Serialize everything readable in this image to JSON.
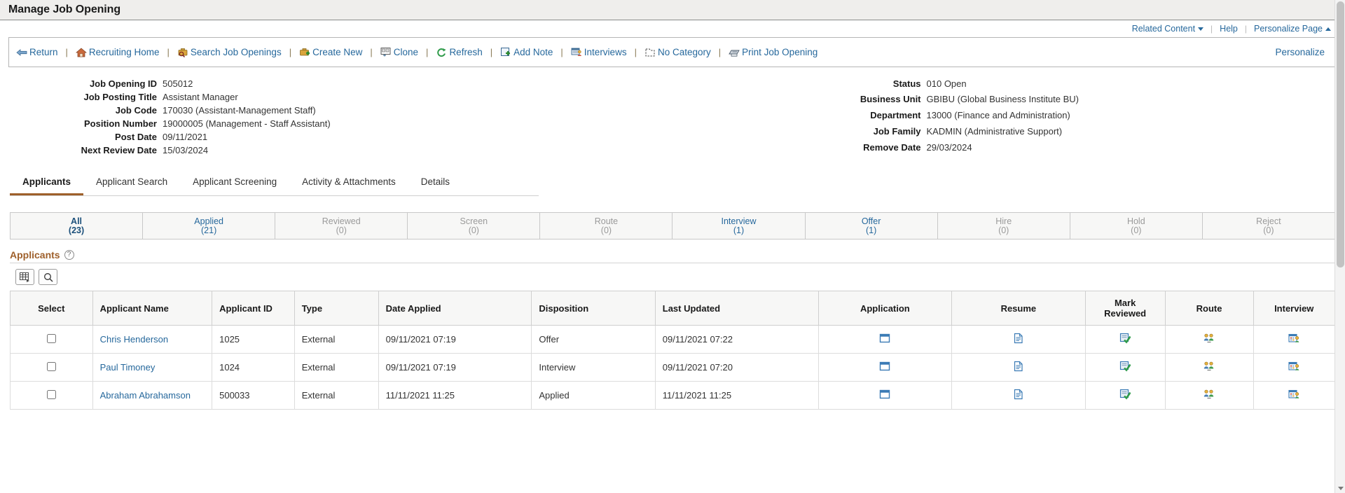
{
  "page": {
    "title": "Manage Job Opening"
  },
  "utility_links": {
    "related_content": "Related Content",
    "help": "Help",
    "personalize_page": "Personalize Page"
  },
  "toolbar": {
    "personalize": "Personalize",
    "separator": "|",
    "items": [
      {
        "label": "Return",
        "icon": "return-arrow-icon"
      },
      {
        "label": "Recruiting Home",
        "icon": "home-icon"
      },
      {
        "label": "Search Job Openings",
        "icon": "search-briefcase-icon"
      },
      {
        "label": "Create New",
        "icon": "briefcase-plus-icon"
      },
      {
        "label": "Clone",
        "icon": "clone-icon"
      },
      {
        "label": "Refresh",
        "icon": "refresh-icon"
      },
      {
        "label": "Add Note",
        "icon": "add-note-icon"
      },
      {
        "label": "Interviews",
        "icon": "interviews-icon"
      },
      {
        "label": "No Category",
        "icon": "no-category-icon"
      },
      {
        "label": "Print Job Opening",
        "icon": "printer-icon"
      }
    ]
  },
  "job_header": {
    "left": [
      {
        "label": "Job Opening ID",
        "value": "505012"
      },
      {
        "label": "Job Posting Title",
        "value": "Assistant Manager"
      },
      {
        "label": "Job Code",
        "value": "170030 (Assistant-Management Staff)"
      },
      {
        "label": "Position Number",
        "value": "19000005 (Management - Staff Assistant)"
      },
      {
        "label": "Post Date",
        "value": "09/11/2021"
      },
      {
        "label": "Next Review Date",
        "value": "15/03/2024"
      }
    ],
    "right": [
      {
        "label": "Status",
        "value": "010 Open"
      },
      {
        "label": "Business Unit",
        "value": "GBIBU (Global Business Institute BU)"
      },
      {
        "label": "Department",
        "value": "13000 (Finance and Administration)"
      },
      {
        "label": "Job Family",
        "value": "KADMIN (Administrative Support)"
      },
      {
        "label": "Remove Date",
        "value": "29/03/2024"
      }
    ]
  },
  "main_tabs": [
    {
      "label": "Applicants",
      "active": true
    },
    {
      "label": "Applicant Search",
      "active": false
    },
    {
      "label": "Applicant Screening",
      "active": false
    },
    {
      "label": "Activity & Attachments",
      "active": false
    },
    {
      "label": "Details",
      "active": false
    }
  ],
  "status_tabs": [
    {
      "name": "All",
      "count": "(23)",
      "state": "active"
    },
    {
      "name": "Applied",
      "count": "(21)",
      "state": "enabled"
    },
    {
      "name": "Reviewed",
      "count": "(0)",
      "state": "disabled"
    },
    {
      "name": "Screen",
      "count": "(0)",
      "state": "disabled"
    },
    {
      "name": "Route",
      "count": "(0)",
      "state": "disabled"
    },
    {
      "name": "Interview",
      "count": "(1)",
      "state": "enabled"
    },
    {
      "name": "Offer",
      "count": "(1)",
      "state": "enabled"
    },
    {
      "name": "Hire",
      "count": "(0)",
      "state": "disabled"
    },
    {
      "name": "Hold",
      "count": "(0)",
      "state": "disabled"
    },
    {
      "name": "Reject",
      "count": "(0)",
      "state": "disabled"
    }
  ],
  "applicants_grid": {
    "title": "Applicants",
    "help_glyph": "?",
    "toolbar_buttons": [
      {
        "icon": "grid-personalize-icon",
        "name": "personalize-grid-button"
      },
      {
        "icon": "search-icon",
        "name": "find-button"
      }
    ],
    "columns": [
      "Select",
      "Applicant Name",
      "Applicant ID",
      "Type",
      "Date Applied",
      "Disposition",
      "Last Updated",
      "Application",
      "Resume",
      "Mark Reviewed",
      "Route",
      "Interview"
    ],
    "rows": [
      {
        "select": false,
        "name": "Chris Henderson",
        "id": "1025",
        "type": "External",
        "date_applied": "09/11/2021 07:19",
        "disposition": "Offer",
        "last_updated": "09/11/2021 07:22",
        "application_icon": "application-window-icon",
        "resume_icon": "resume-document-icon",
        "mark_reviewed_icon": "mark-reviewed-icon",
        "route_icon": "route-people-icon",
        "interview_icon": "interview-calendar-icon"
      },
      {
        "select": false,
        "name": "Paul Timoney",
        "id": "1024",
        "type": "External",
        "date_applied": "09/11/2021 07:19",
        "disposition": "Interview",
        "last_updated": "09/11/2021 07:20",
        "application_icon": "application-window-icon",
        "resume_icon": "resume-document-icon",
        "mark_reviewed_icon": "mark-reviewed-icon",
        "route_icon": "route-people-icon",
        "interview_icon": "interview-calendar-icon"
      },
      {
        "select": false,
        "name": "Abraham Abrahamson",
        "id": "500033",
        "type": "External",
        "date_applied": "11/11/2021 11:25",
        "disposition": "Applied",
        "last_updated": "11/11/2021 11:25",
        "application_icon": "application-window-icon",
        "resume_icon": "resume-document-icon",
        "mark_reviewed_icon": "mark-reviewed-icon",
        "route_icon": "route-people-icon",
        "interview_icon": "interview-calendar-icon"
      }
    ]
  },
  "colors": {
    "link": "#26689c",
    "accent": "#9e5f2a",
    "titlebar_bg": "#efeeec"
  }
}
